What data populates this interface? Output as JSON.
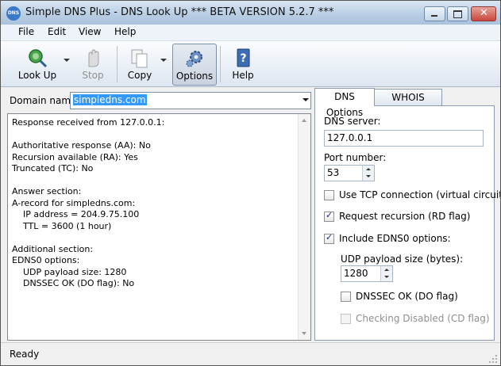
{
  "window": {
    "title": "Simple DNS Plus - DNS Look Up  *** BETA VERSION 5.2.7 ***",
    "app_icon_text": "DNS"
  },
  "menu": [
    "File",
    "Edit",
    "View",
    "Help"
  ],
  "toolbar": {
    "lookup": "Look Up",
    "stop": "Stop",
    "copy": "Copy",
    "options": "Options",
    "help": "Help"
  },
  "domain": {
    "label": "Domain name:",
    "value": "simpledns.com"
  },
  "result_text": "Response received from 127.0.0.1:\n\nAuthoritative response (AA): No\nRecursion available (RA): Yes\nTruncated (TC): No\n\nAnswer section:\nA-record for simpledns.com:\n    IP address = 204.9.75.100\n    TTL = 3600 (1 hour)\n\nAdditional section:\nEDNS0 options:\n    UDP payload size: 1280\n    DNSSEC OK (DO flag): No",
  "tabs": {
    "dns_options": "DNS Options",
    "whois_options": "WHOIS Options"
  },
  "options": {
    "dns_server_label": "DNS server:",
    "dns_server": "127.0.0.1",
    "port_label": "Port number:",
    "port": "53",
    "use_tcp": "Use TCP connection (virtual circuit)",
    "request_recursion": "Request recursion (RD flag)",
    "include_edns0": "Include EDNS0 options:",
    "udp_size_label": "UDP payload size (bytes):",
    "udp_size": "1280",
    "dnssec_ok": "DNSSEC OK (DO flag)",
    "checking_disabled": "Checking Disabled (CD flag)"
  },
  "status": "Ready",
  "colors": {
    "selection": "#3399ff",
    "titlebar": "#b7cde3"
  }
}
